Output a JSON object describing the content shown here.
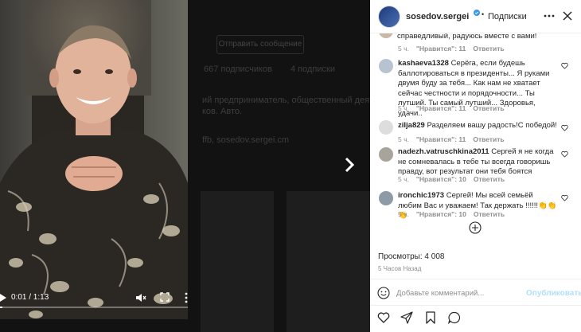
{
  "background_page": {
    "send_message_label": "Отправить сообщение",
    "followers_text": "667 подписчиков",
    "following_text": "4 подписки",
    "bio_line_1": "ий предприниматель, общественный деятель, юрист",
    "bio_line_2": "ков. Авто.",
    "link_text": "ffb, sosedov.sergei.cm"
  },
  "video": {
    "time": "0:01 / 1:13",
    "progress_fraction": 0.013
  },
  "post": {
    "username": "sosedov.sergei",
    "separator": "•",
    "follow_label": "Подписки",
    "partial_comment": "справедливый, радуюсь вместе с вами!",
    "likes_label": "Просмотры: 4 008",
    "time_ago": "5 Часов Назад",
    "comment_placeholder": "Добавьте комментарий...",
    "publish_label": "Опубликовать"
  },
  "comments": [
    {
      "user": "kashaeva1328",
      "text": "Серёга, если будешь баллотироваться в президенты... Я руками двумя буду за тебя... Как нам не хватает сейчас честности и порядочности... Ты лутший. Ты самый лутший... Здоровья, удачи..",
      "time": "5 ч.",
      "likes": "\"Нравится\": 11",
      "reply": "Ответить"
    },
    {
      "user": "zilja829",
      "text": "Разделяем вашу радость!С победой!",
      "time": "5 ч.",
      "likes": "\"Нравится\": 11",
      "reply": "Ответить"
    },
    {
      "user": "nadezh.vatruschkina2011",
      "text": "Сергей я не когда не сомневалась в тебе ты всегда говоришь правду, вот результат они тебя боятся",
      "time": "5 ч.",
      "likes": "\"Нравится\": 10",
      "reply": "Ответить"
    },
    {
      "user": "ironchic1973",
      "text": "Сергей! Мы всей семьёй любим Вас и уважаем! Так держать !!!!!!👏👏👏",
      "time": "5 ч.",
      "likes": "\"Нравится\": 10",
      "reply": "Ответить"
    }
  ],
  "partial_meta": {
    "time": "5 ч.",
    "likes": "\"Нравится\": 11",
    "reply": "Ответить"
  },
  "icons": {
    "verified": "verified-badge-icon",
    "more": "more-options-icon",
    "close": "close-icon",
    "heart": "heart-icon",
    "add": "plus-circle-icon",
    "emoji": "emoji-icon",
    "like": "heart-icon",
    "share": "paper-plane-icon",
    "save": "bookmark-icon",
    "comment": "speech-bubble-icon"
  },
  "colors": {
    "accent": "#0095f6",
    "publish_disabled": "#b2dffc",
    "verified": "#3897f0"
  }
}
